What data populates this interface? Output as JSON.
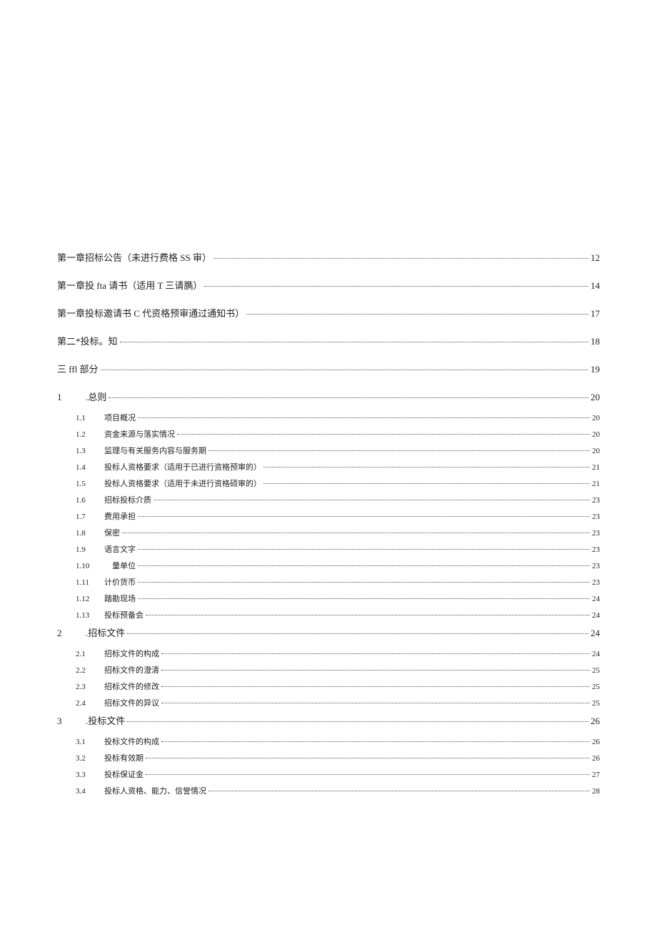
{
  "toc": [
    {
      "type": "chapter",
      "label": "第一章招标公告（未进行费格 SS 审）",
      "page": "12"
    },
    {
      "type": "chapter",
      "label": "第一章投 fta 请书（适用 T 三请臇）",
      "page": "14"
    },
    {
      "type": "chapter",
      "label": "第一章投标邀请书 C 代资格预审通过通知书）",
      "page": "17"
    },
    {
      "type": "chapter",
      "label": "第二*投标。知",
      "page": "18"
    },
    {
      "type": "chapter",
      "label": "三 ffl 部分",
      "page": "19"
    },
    {
      "type": "section",
      "num": "1",
      "label": ".总则",
      "page": "20"
    },
    {
      "type": "sub",
      "num": "1.1",
      "label": "项目概况",
      "page": "20"
    },
    {
      "type": "sub",
      "num": "1.2",
      "label": "资金来源与落实情况",
      "page": "20"
    },
    {
      "type": "sub",
      "num": "1.3",
      "label": "监理与有关服务内容与服务期",
      "page": "20"
    },
    {
      "type": "sub",
      "num": "1.4",
      "label": "投标人资格要求（适用于已进行资格预审的）",
      "page": "21"
    },
    {
      "type": "sub",
      "num": "1.5",
      "label": "投标人资格要求（适用于未进行资格硕审的）",
      "page": "21"
    },
    {
      "type": "sub",
      "num": "1.6",
      "label": "招标投标介质",
      "page": "23"
    },
    {
      "type": "sub",
      "num": "1.7",
      "label": "费用承担",
      "page": "23"
    },
    {
      "type": "sub",
      "num": "1.8",
      "label": "保密",
      "page": "23"
    },
    {
      "type": "sub",
      "num": "1.9",
      "label": "语言文字",
      "page": "23"
    },
    {
      "type": "sub",
      "num": "1.10",
      "label": " 量单位",
      "page": "23"
    },
    {
      "type": "sub",
      "num": "1.11",
      "label": "计价货币",
      "page": "23"
    },
    {
      "type": "sub",
      "num": "1.12",
      "label": "踏勘现场",
      "page": "24"
    },
    {
      "type": "sub",
      "num": "1.13",
      "label": "投标预备会",
      "page": "24"
    },
    {
      "type": "section",
      "num": "2",
      "label": ".招标文件",
      "page": "24",
      "indent": true
    },
    {
      "type": "sub",
      "num": "2.1",
      "label": "招标文件的构成",
      "page": "24"
    },
    {
      "type": "sub",
      "num": "2.2",
      "label": "招标文件的澄清",
      "page": "25"
    },
    {
      "type": "sub",
      "num": "2.3",
      "label": "招标文件的修改",
      "page": "25"
    },
    {
      "type": "sub",
      "num": "2.4",
      "label": "招标文件的异议",
      "page": "25"
    },
    {
      "type": "section",
      "num": "3",
      "label": ".投标文件",
      "page": "26",
      "indent": true
    },
    {
      "type": "sub",
      "num": "3.1",
      "label": "投标文件的构成",
      "page": "26"
    },
    {
      "type": "sub",
      "num": "3.2",
      "label": "投标有效期",
      "page": "26"
    },
    {
      "type": "sub",
      "num": "3.3",
      "label": "投标保证金",
      "page": "27"
    },
    {
      "type": "sub",
      "num": "3.4",
      "label": "投标人资格、能力、信誉情况",
      "page": "28"
    }
  ]
}
